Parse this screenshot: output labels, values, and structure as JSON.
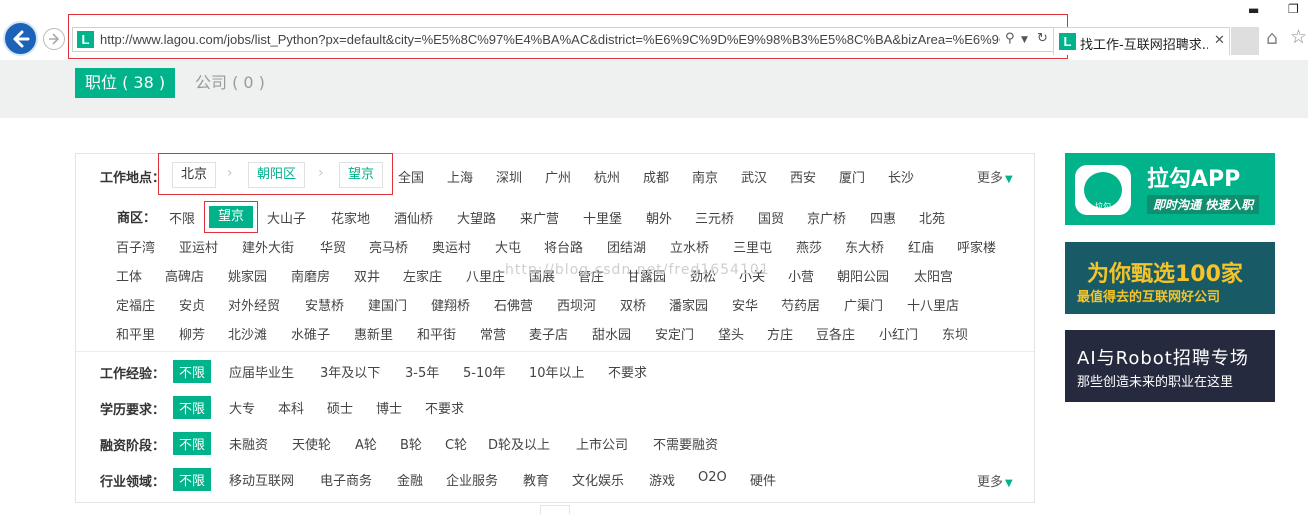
{
  "browser": {
    "url": "http://www.lagou.com/jobs/list_Python?px=default&city=%E5%8C%97%E4%BA%AC&district=%E6%9C%9D%E9%98%B3%E5%8C%BA&bizArea=%E6%9C%9",
    "tab_title": "找工作-互联网招聘求...",
    "favicon_letter": "L",
    "icons": [
      "back-icon",
      "forward-icon",
      "search-icon",
      "dropdown-icon",
      "refresh-icon",
      "close-icon",
      "home-icon",
      "star-icon"
    ]
  },
  "header": {
    "positions_tab": "职位 ( 38 )",
    "companies_tab": "公司 ( 0 )"
  },
  "filters": {
    "location_label": "工作地点：",
    "location_path": [
      "北京",
      "朝阳区",
      "望京"
    ],
    "cities": [
      "全国",
      "上海",
      "深圳",
      "广州",
      "杭州",
      "成都",
      "南京",
      "武汉",
      "西安",
      "厦门",
      "长沙"
    ],
    "more": "更多",
    "biz_label": "商区：",
    "biz_unlimited": "不限",
    "biz_selected": "望京",
    "biz_rows": [
      [
        "大山子",
        "花家地",
        "酒仙桥",
        "大望路",
        "来广营",
        "十里堡",
        "朝外",
        "三元桥",
        "国贸",
        "京广桥",
        "四惠",
        "北苑"
      ],
      [
        "百子湾",
        "亚运村",
        "建外大街",
        "华贸",
        "亮马桥",
        "奥运村",
        "大屯",
        "将台路",
        "团结湖",
        "立水桥",
        "三里屯",
        "燕莎",
        "东大桥",
        "红庙",
        "呼家楼"
      ],
      [
        "工体",
        "高碑店",
        "姚家园",
        "南磨房",
        "双井",
        "左家庄",
        "八里庄",
        "国展",
        "管庄",
        "甘露园",
        "劲松",
        "小关",
        "小营",
        "朝阳公园",
        "太阳宫"
      ],
      [
        "定福庄",
        "安贞",
        "对外经贸",
        "安慧桥",
        "建国门",
        "健翔桥",
        "石佛营",
        "西坝河",
        "双桥",
        "潘家园",
        "安华",
        "芍药居",
        "广渠门",
        "十八里店"
      ],
      [
        "和平里",
        "柳芳",
        "北沙滩",
        "水碓子",
        "惠新里",
        "和平街",
        "常营",
        "麦子店",
        "甜水园",
        "安定门",
        "垡头",
        "方庄",
        "豆各庄",
        "小红门",
        "东坝"
      ]
    ],
    "experience": {
      "label": "工作经验：",
      "options": [
        "不限",
        "应届毕业生",
        "3年及以下",
        "3-5年",
        "5-10年",
        "10年以上",
        "不要求"
      ]
    },
    "education": {
      "label": "学历要求：",
      "options": [
        "不限",
        "大专",
        "本科",
        "硕士",
        "博士",
        "不要求"
      ]
    },
    "financing": {
      "label": "融资阶段：",
      "options": [
        "不限",
        "未融资",
        "天使轮",
        "A轮",
        "B轮",
        "C轮",
        "D轮及以上",
        "上市公司",
        "不需要融资"
      ]
    },
    "industry": {
      "label": "行业领域：",
      "options": [
        "不限",
        "移动互联网",
        "电子商务",
        "金融",
        "企业服务",
        "教育",
        "文化娱乐",
        "游戏",
        "O2O",
        "硬件"
      ],
      "more": "更多"
    },
    "watermark": "http://blog.csdn.net/fred1654101"
  },
  "ads": {
    "app_title": "拉勾APP",
    "app_sub": "即时沟通 快速入职",
    "app_logo_text": "拉勾",
    "hundred_title": "为你甄选100家",
    "hundred_sub": "最值得去的互联网好公司",
    "ai_title": "AI与Robot招聘专场",
    "ai_sub": "那些创造未来的职业在这里"
  },
  "colors": {
    "brand_green": "#00b38a",
    "highlight_red": "#e0323a"
  }
}
